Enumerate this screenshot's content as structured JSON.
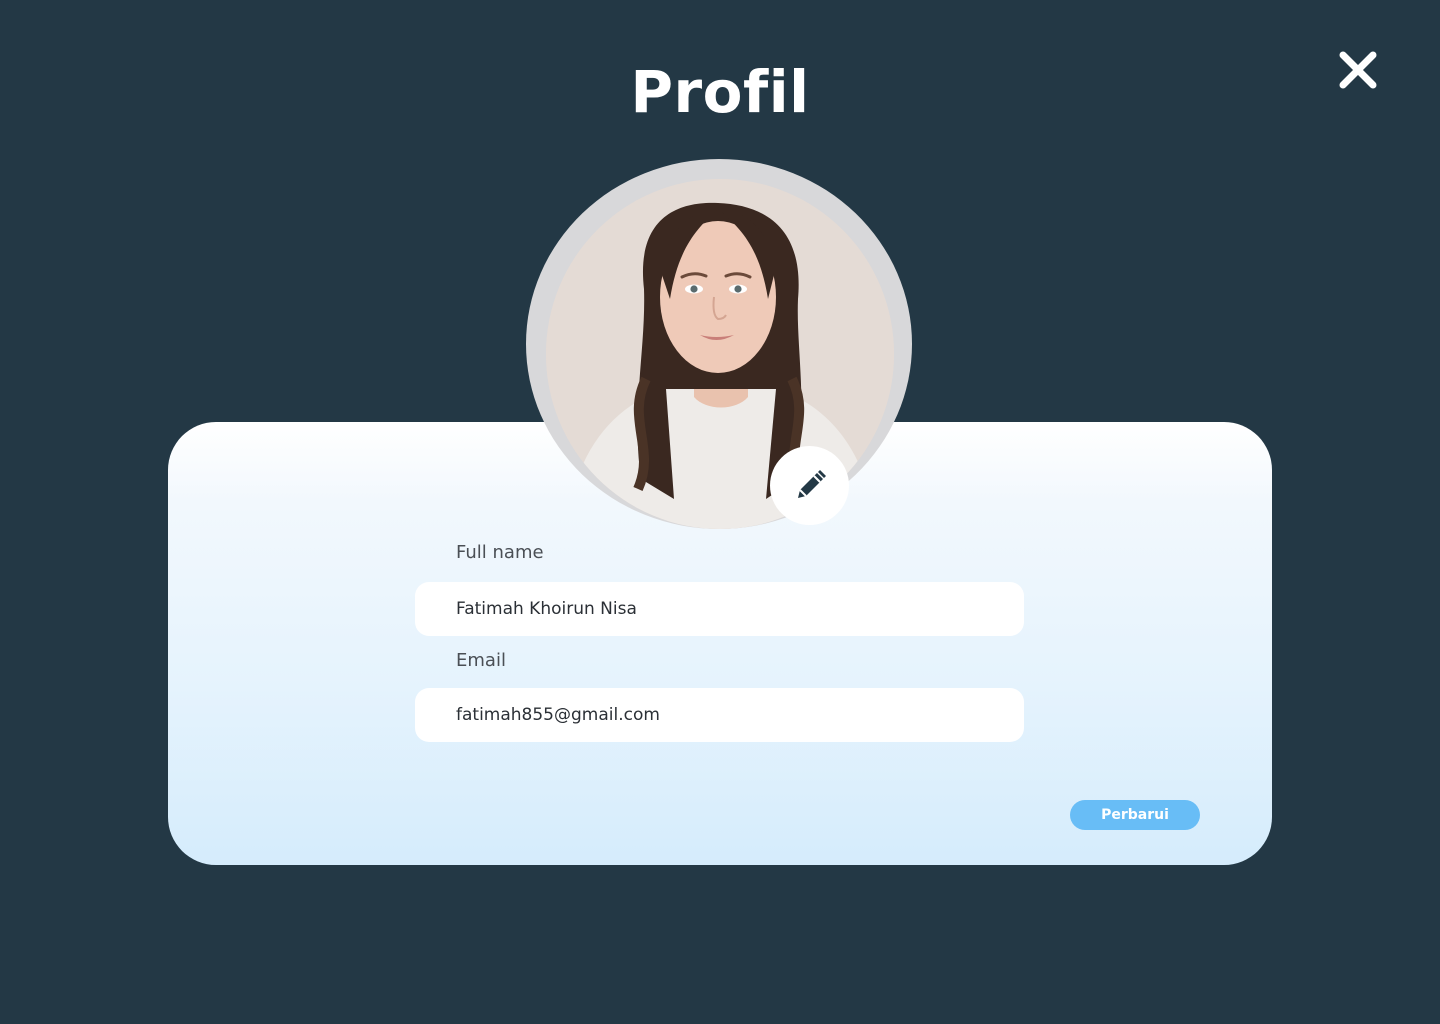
{
  "header": {
    "title": "Profil"
  },
  "icons": {
    "close": "close-icon",
    "edit": "pencil-icon"
  },
  "profile": {
    "photo": "profile-photo",
    "full_name_label": "Full name",
    "full_name_value": "Fatimah Khoirun Nisa",
    "email_label": "Email",
    "email_value": "fatimah855@gmail.com"
  },
  "actions": {
    "update_label": "Perbarui"
  },
  "colors": {
    "background": "#233845",
    "card_top": "#ffffff",
    "card_bottom": "#d5ecfc",
    "accent": "#68bdf6",
    "text_dark": "#2b3036"
  }
}
